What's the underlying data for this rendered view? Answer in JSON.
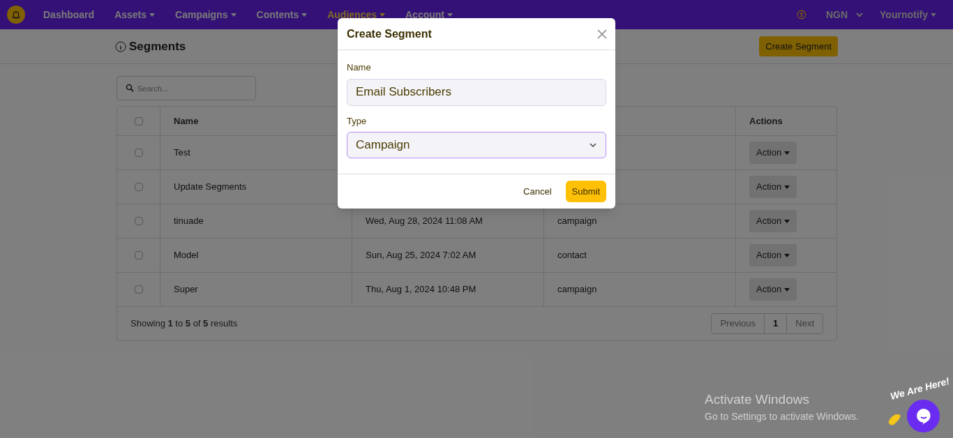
{
  "nav": {
    "items": [
      {
        "label": "Dashboard",
        "dropdown": false,
        "selected": false
      },
      {
        "label": "Assets",
        "dropdown": true,
        "selected": false
      },
      {
        "label": "Campaigns",
        "dropdown": true,
        "selected": false
      },
      {
        "label": "Contents",
        "dropdown": true,
        "selected": false
      },
      {
        "label": "Audiences",
        "dropdown": true,
        "selected": true
      },
      {
        "label": "Account",
        "dropdown": true,
        "selected": false
      }
    ],
    "currency": "NGN",
    "user": "Yournotify"
  },
  "page": {
    "title": "Segments",
    "create_button": "Create Segment"
  },
  "search": {
    "placeholder": "Search..."
  },
  "table": {
    "select_all_checked": false,
    "columns": [
      {
        "label": "Name"
      },
      {
        "label": "Actions"
      }
    ],
    "rows": [
      {
        "checked": false,
        "name": "Test",
        "action": "Action"
      },
      {
        "checked": false,
        "name": "Update Segments",
        "action": "Action"
      },
      {
        "checked": false,
        "name": "tinuade",
        "date": "Wed, Aug 28, 2024 11:08 AM",
        "type": "campaign",
        "action": "Action"
      },
      {
        "checked": false,
        "name": "Model",
        "date": "Sun, Aug 25, 2024 7:02 AM",
        "type": "contact",
        "action": "Action"
      },
      {
        "checked": false,
        "name": "Super",
        "date": "Thu, Aug 1, 2024 10:48 PM",
        "type": "campaign",
        "action": "Action"
      }
    ],
    "summary": "Showing **1** to **5** of **5** results",
    "pagination": [
      {
        "label": "Previous",
        "selected": false
      },
      {
        "label": "1",
        "selected": true
      },
      {
        "label": "Next",
        "selected": false
      }
    ]
  },
  "modal": {
    "title": "Create Segment",
    "fields": [
      {
        "kind": "text",
        "label": "Name",
        "value": "Email Subscribers"
      },
      {
        "kind": "select",
        "label": "Type",
        "value": "Campaign"
      }
    ],
    "buttons": [
      {
        "kind": "plain",
        "label": "Cancel"
      },
      {
        "kind": "primary",
        "label": "Submit"
      }
    ]
  },
  "os_notice": {
    "title": "Activate Windows",
    "text": "Go to Settings to activate Windows."
  },
  "chat_widget": {
    "caption": "We Are Here!"
  }
}
